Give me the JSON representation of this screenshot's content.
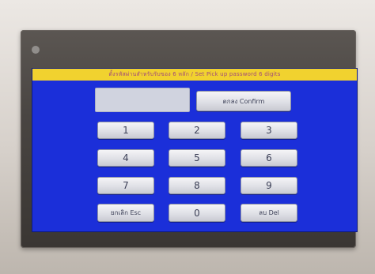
{
  "header": {
    "title": "ตั้งรหัสผ่านสำหรับรับของ 6 หลัก / Set Pick up password 6 digits"
  },
  "password": {
    "value": ""
  },
  "buttons": {
    "confirm": "ตกลง Confirm",
    "k1": "1",
    "k2": "2",
    "k3": "3",
    "k4": "4",
    "k5": "5",
    "k6": "6",
    "k7": "7",
    "k8": "8",
    "k9": "9",
    "k0": "0",
    "esc": "ยกเลิก Esc",
    "del": "ลบ Del"
  }
}
